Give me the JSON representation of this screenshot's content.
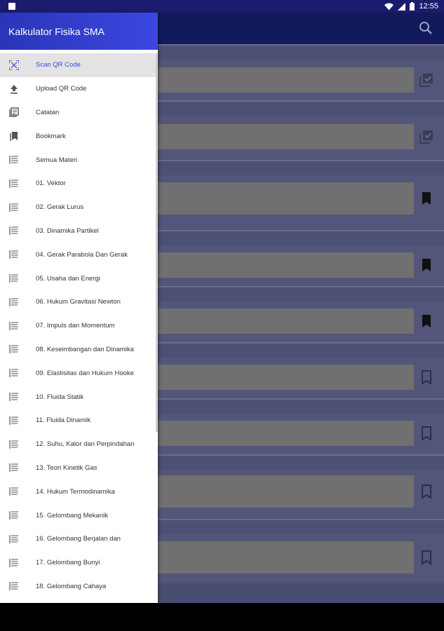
{
  "status_bar": {
    "time": "12:55",
    "icons": [
      "notification-icon",
      "wifi-icon",
      "signal-icon",
      "battery-icon"
    ]
  },
  "drawer": {
    "title": "Kalkulator Fisika SMA",
    "accent": "#3b47e0",
    "items": [
      {
        "label": "Scan QR Code",
        "icon": "qr-scan-icon",
        "active": true
      },
      {
        "label": "Upload QR Code",
        "icon": "upload-icon"
      },
      {
        "label": "Catatan",
        "icon": "notes-icon"
      },
      {
        "label": "Bookmark",
        "icon": "bookmark-stack-icon"
      },
      {
        "label": "Semua Materi",
        "icon": "list-icon"
      },
      {
        "label": "01. Vektor",
        "icon": "list-icon"
      },
      {
        "label": "02. Gerak Lurus",
        "icon": "list-icon"
      },
      {
        "label": "03. Dinamika Partikel",
        "icon": "list-icon"
      },
      {
        "label": "04. Gerak Parabola Dan Gerak",
        "icon": "list-icon"
      },
      {
        "label": "05. Usaha dan Energi",
        "icon": "list-icon"
      },
      {
        "label": "06. Hukum Gravitasi Newton",
        "icon": "list-icon"
      },
      {
        "label": "07. Impuls dan Momentum",
        "icon": "list-icon"
      },
      {
        "label": "08. Keseimbangan dan Dinamika",
        "icon": "list-icon"
      },
      {
        "label": "09. Elastisitas dan Hukum Hooke",
        "icon": "list-icon"
      },
      {
        "label": "10. Fluida Statik",
        "icon": "list-icon"
      },
      {
        "label": "11. Fluida Dinamik",
        "icon": "list-icon"
      },
      {
        "label": "12. Suhu, Kalor dan Perpindahan",
        "icon": "list-icon"
      },
      {
        "label": "13. Teori Kinetik Gas",
        "icon": "list-icon"
      },
      {
        "label": "14. Hukum Termodinamika",
        "icon": "list-icon"
      },
      {
        "label": "15. Gelombang Mekanik",
        "icon": "list-icon"
      },
      {
        "label": "16. Gelombang Berjalan dan",
        "icon": "list-icon"
      },
      {
        "label": "17. Gelombang Bunyi",
        "icon": "list-icon"
      },
      {
        "label": "18. Gelombang Cahaya",
        "icon": "list-icon"
      }
    ]
  },
  "main": {
    "toolbar_icon": "search-icon",
    "cards": [
      {
        "mark": "checked"
      },
      {
        "mark": "checked"
      },
      {
        "mark": "bookmarked"
      },
      {
        "mark": "bookmarked"
      },
      {
        "mark": "bookmarked"
      },
      {
        "mark": "bookmark"
      },
      {
        "mark": "bookmark"
      },
      {
        "mark": "bookmark"
      },
      {
        "mark": "bookmark"
      }
    ]
  }
}
